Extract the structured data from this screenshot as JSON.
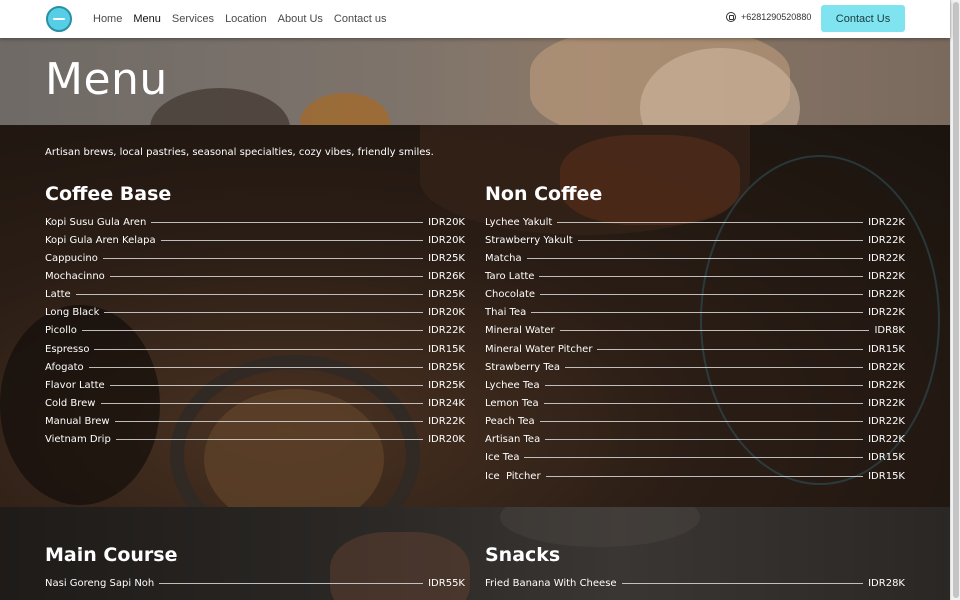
{
  "nav": {
    "links": [
      "Home",
      "Menu",
      "Services",
      "Location",
      "About Us",
      "Contact us"
    ],
    "active": "Menu",
    "phone": "+6281290520880",
    "phone_icon": "whatsapp-icon",
    "cta": "Contact Us"
  },
  "colors": {
    "accent": "#7fe3f0",
    "logo": "#56cfe6"
  },
  "hero": {
    "title": "Menu"
  },
  "menu": {
    "tagline": "Artisan brews, local pastries, seasonal specialties, cozy vibes, friendly smiles.",
    "coffee": {
      "title": "Coffee Base",
      "items": [
        {
          "name": "Kopi Susu Gula Aren",
          "price": "IDR20K"
        },
        {
          "name": "Kopi Gula Aren Kelapa",
          "price": "IDR20K"
        },
        {
          "name": "Cappucino",
          "price": "IDR25K"
        },
        {
          "name": "Mochacinno",
          "price": "IDR26K"
        },
        {
          "name": "Latte",
          "price": "IDR25K"
        },
        {
          "name": "Long Black",
          "price": "IDR20K"
        },
        {
          "name": "Picollo",
          "price": "IDR22K"
        },
        {
          "name": "Espresso",
          "price": "IDR15K"
        },
        {
          "name": "Afogato",
          "price": "IDR25K"
        },
        {
          "name": "Flavor Latte",
          "price": "IDR25K"
        },
        {
          "name": "Cold Brew",
          "price": "IDR24K"
        },
        {
          "name": "Manual Brew",
          "price": "IDR22K"
        },
        {
          "name": "Vietnam Drip",
          "price": "IDR20K"
        }
      ]
    },
    "noncoffee": {
      "title": "Non Coffee",
      "items": [
        {
          "name": "Lychee Yakult",
          "price": "IDR22K"
        },
        {
          "name": "Strawberry Yakult",
          "price": "IDR22K"
        },
        {
          "name": "Matcha",
          "price": "IDR22K"
        },
        {
          "name": "Taro Latte",
          "price": "IDR22K"
        },
        {
          "name": "Chocolate",
          "price": "IDR22K"
        },
        {
          "name": "Thai Tea",
          "price": "IDR22K"
        },
        {
          "name": "Mineral Water",
          "price": "IDR8K"
        },
        {
          "name": "Mineral Water Pitcher",
          "price": "IDR15K"
        },
        {
          "name": "Strawberry Tea",
          "price": "IDR22K"
        },
        {
          "name": "Lychee Tea",
          "price": "IDR22K"
        },
        {
          "name": "Lemon Tea",
          "price": "IDR22K"
        },
        {
          "name": "Peach Tea",
          "price": "IDR22K"
        },
        {
          "name": "Artisan Tea",
          "price": "IDR22K"
        },
        {
          "name": "Ice Tea",
          "price": "IDR15K"
        },
        {
          "name": "Ice  Pitcher",
          "price": "IDR15K"
        }
      ]
    },
    "maincourse": {
      "title": "Main Course",
      "items": [
        {
          "name": "Nasi Goreng Sapi Noh",
          "price": "IDR55K"
        }
      ]
    },
    "snacks": {
      "title": "Snacks",
      "items": [
        {
          "name": "Fried Banana With Cheese",
          "price": "IDR28K"
        }
      ]
    }
  }
}
